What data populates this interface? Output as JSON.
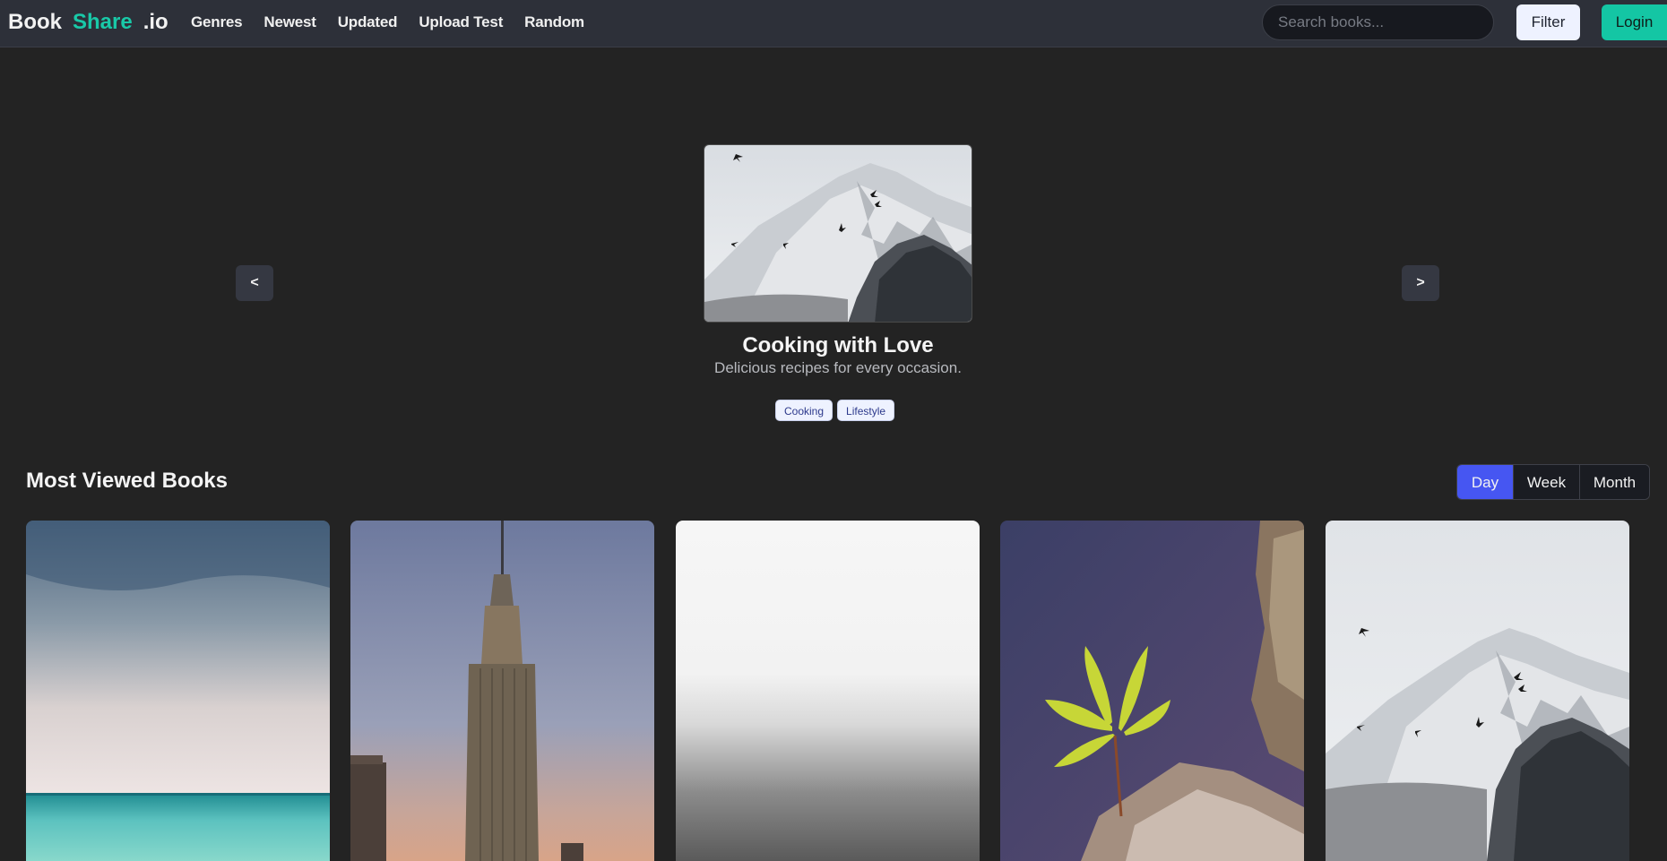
{
  "brand": {
    "part1": "Book",
    "part2": "Share",
    "part3": ".io"
  },
  "nav": {
    "links": [
      "Genres",
      "Newest",
      "Updated",
      "Upload Test",
      "Random"
    ]
  },
  "search": {
    "placeholder": "Search books..."
  },
  "buttons": {
    "filter": "Filter",
    "login": "Login"
  },
  "hero": {
    "prev_label": "<",
    "next_label": ">",
    "title": "Cooking with Love",
    "description": "Delicious recipes for every occasion.",
    "tags": [
      "Cooking",
      "Lifestyle"
    ],
    "cover_image": "snowy-mountain-with-birds"
  },
  "most_viewed": {
    "title": "Most Viewed Books",
    "periods": [
      "Day",
      "Week",
      "Month"
    ],
    "active_period": "Day",
    "books": [
      {
        "cover_image": "cloudy-sea-horizon"
      },
      {
        "cover_image": "empire-state-building"
      },
      {
        "cover_image": "foggy-grey-sea"
      },
      {
        "cover_image": "green-plant-on-rock"
      },
      {
        "cover_image": "snowy-mountain-with-birds"
      }
    ]
  },
  "colors": {
    "accent": "#14c6a4",
    "active_tab": "#4656f2",
    "background": "#232323",
    "navbar": "#2d3039"
  }
}
